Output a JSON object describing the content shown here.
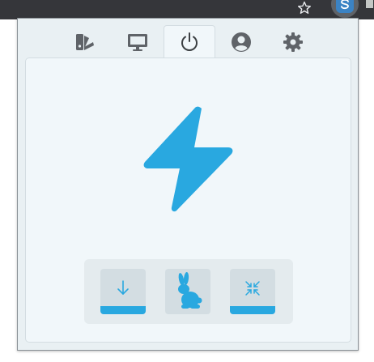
{
  "browser": {
    "bookmark_icon": "star-icon",
    "extension_icon": "extension-s-icon"
  },
  "popup": {
    "tabs": [
      {
        "icon": "palette-icon",
        "active": false
      },
      {
        "icon": "monitor-icon",
        "active": false
      },
      {
        "icon": "power-icon",
        "active": true
      },
      {
        "icon": "account-icon",
        "active": false
      },
      {
        "icon": "gear-icon",
        "active": false
      }
    ],
    "main_icon": "lightning-bolt-icon",
    "actions": [
      {
        "icon": "arrow-down-icon",
        "selected": true
      },
      {
        "icon": "rabbit-icon",
        "selected": false
      },
      {
        "icon": "compress-icon",
        "selected": true
      }
    ]
  },
  "colors": {
    "accent": "#29a8e0",
    "icon_gray": "#5f6368",
    "panel_bg": "#f1f7fa",
    "frame_bg": "#e9f0f3",
    "button_bg": "#d3dde2"
  }
}
